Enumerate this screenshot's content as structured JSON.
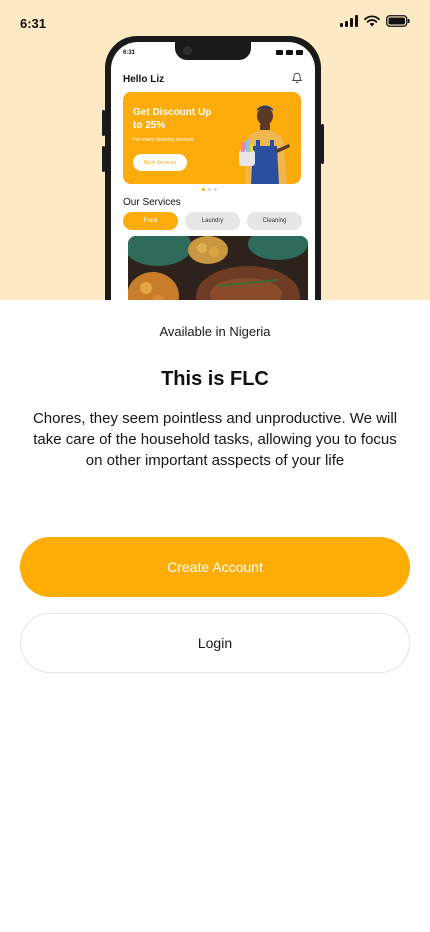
{
  "status_bar": {
    "time": "6:31"
  },
  "mockup": {
    "status_time": "6:31",
    "greeting": "Hello Liz",
    "banner": {
      "title": "Get Discount Up to 25%",
      "subtitle": "For every cleaning services",
      "button_label": "Book Services"
    },
    "services_heading": "Our Services",
    "chips": [
      "Food",
      "Laundry",
      "Cleaning"
    ],
    "active_chip": "Food"
  },
  "main": {
    "availability": "Available in Nigeria",
    "title": "This is FLC",
    "description": "Chores, they seem pointless and unproductive. We will take care of the household tasks, allowing you to focus on other important asspects of your life"
  },
  "actions": {
    "create_account_label": "Create Account",
    "login_label": "Login"
  },
  "colors": {
    "accent": "#fdad04",
    "hero_background": "#fdeac4",
    "text": "#161616"
  },
  "icons": [
    "signal-icon",
    "wifi-icon",
    "battery-icon",
    "bell-icon"
  ]
}
